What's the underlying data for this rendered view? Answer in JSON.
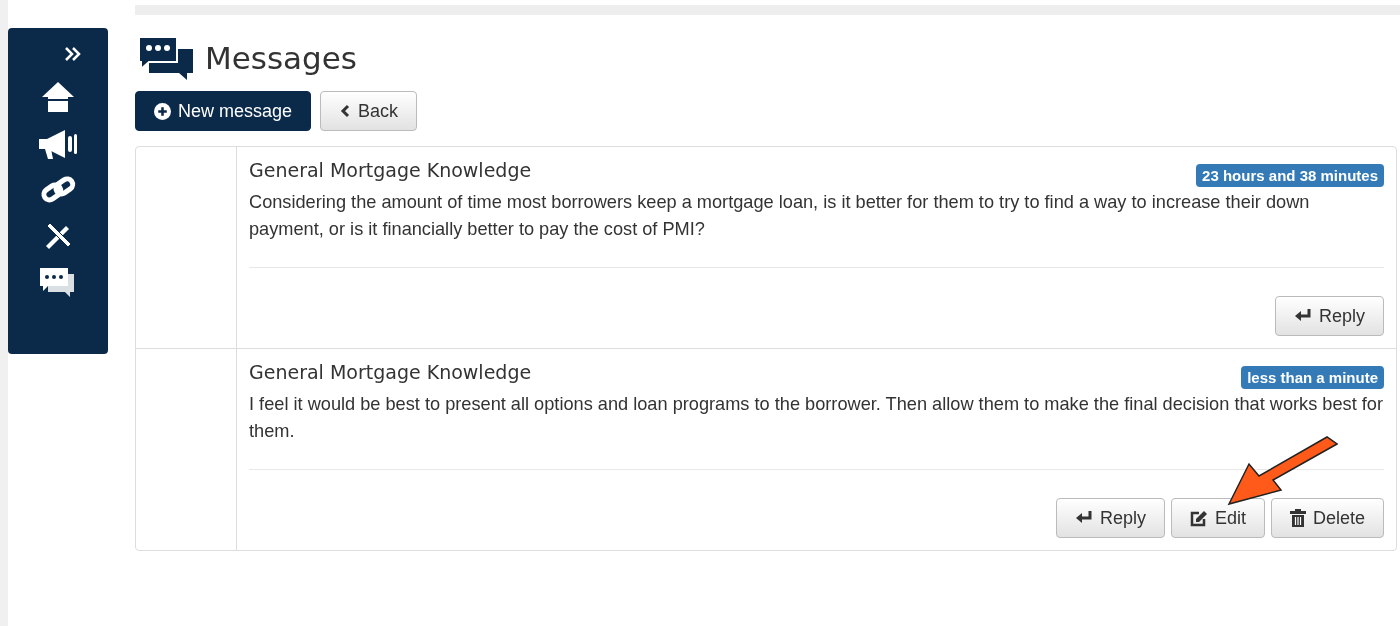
{
  "sidebar": {
    "items": [
      {
        "kind": "expand"
      },
      {
        "kind": "home"
      },
      {
        "kind": "megaphone"
      },
      {
        "kind": "link"
      },
      {
        "kind": "tools"
      },
      {
        "kind": "chat"
      }
    ]
  },
  "page": {
    "title": "Messages"
  },
  "toolbar": [
    {
      "kind": "new",
      "label": "New message"
    },
    {
      "kind": "back",
      "label": "Back"
    }
  ],
  "messages": [
    {
      "title": "General Mortgage Knowledge",
      "time": "23 hours and 38 minutes",
      "body": "Considering the amount of time most borrowers keep a mortgage loan, is it better for them to try to find a way to increase their down payment, or is it financially better to pay the cost of PMI?",
      "actions": [
        {
          "kind": "reply",
          "label": "Reply"
        }
      ]
    },
    {
      "title": "General Mortgage Knowledge",
      "time": "less than a minute",
      "body": "I feel it would be best to present all options and loan programs to the borrower. Then allow them to make the final decision that works best for them.",
      "actions": [
        {
          "kind": "reply",
          "label": "Reply"
        },
        {
          "kind": "edit",
          "label": "Edit"
        },
        {
          "kind": "delete",
          "label": "Delete"
        }
      ]
    }
  ]
}
